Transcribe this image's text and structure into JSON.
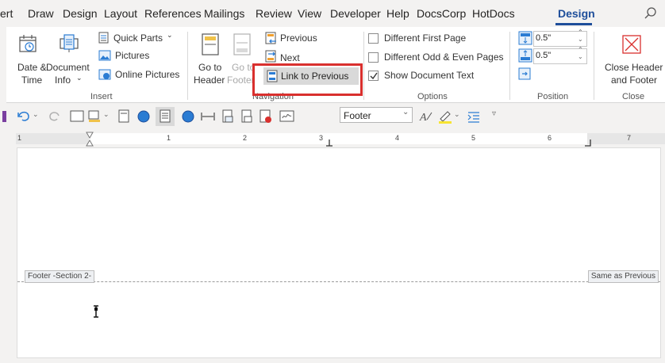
{
  "menu": {
    "tabs": [
      "ert",
      "Draw",
      "Design",
      "Layout",
      "References",
      "Mailings",
      "Review",
      "View",
      "Developer",
      "Help",
      "DocsCorp",
      "HotDocs"
    ],
    "active_tab": "Design"
  },
  "ribbon": {
    "insert": {
      "date_time": [
        "Date &",
        "Time"
      ],
      "document_info": [
        "Document",
        "Info"
      ],
      "quick_parts": "Quick Parts",
      "pictures": "Pictures",
      "online_pictures": "Online Pictures",
      "group_label": "Insert"
    },
    "navigation": {
      "go_to_header": [
        "Go to",
        "Header"
      ],
      "go_to_footer": [
        "Go to",
        "Footer"
      ],
      "previous": "Previous",
      "next": "Next",
      "link_to_previous": "Link to Previous",
      "group_label": "Navigation"
    },
    "options": {
      "different_first_page": "Different First Page",
      "different_odd_even": "Different Odd & Even Pages",
      "show_document_text": "Show Document Text",
      "show_document_text_checked": true,
      "group_label": "Options"
    },
    "position": {
      "header_from_top": "0.5\"",
      "footer_from_bottom": "0.5\"",
      "group_label": "Position"
    },
    "close": {
      "label": [
        "Close Header",
        "and Footer"
      ],
      "group_label": "Close"
    }
  },
  "qat": {
    "style_value": "Footer"
  },
  "ruler": {
    "numbers": [
      "1",
      "1",
      "2",
      "3",
      "4",
      "5",
      "6",
      "7"
    ]
  },
  "document": {
    "footer_tag": "Footer -Section 2-",
    "same_as_previous": "Same as Previous"
  },
  "colors": {
    "accent": "#1e4e9a",
    "highlight": "#d9302e",
    "close_icon": "#d9302e"
  }
}
